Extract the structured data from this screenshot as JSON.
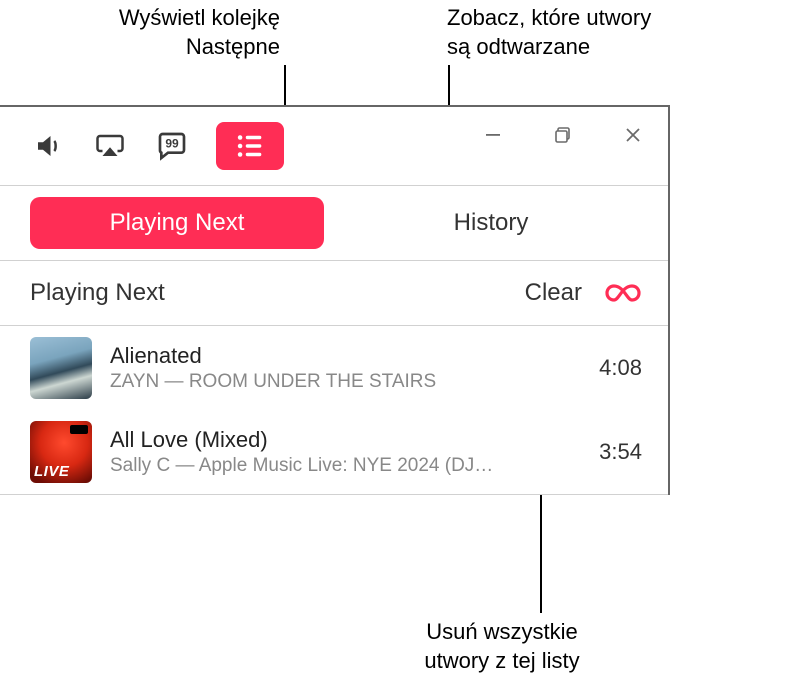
{
  "callouts": {
    "topLeft_l1": "Wyświetl kolejkę",
    "topLeft_l2": "Następne",
    "topRight_l1": "Zobacz, które utwory",
    "topRight_l2": "są odtwarzane",
    "bottom_l1": "Usuń wszystkie",
    "bottom_l2": "utwory z tej listy"
  },
  "tabs": {
    "playingNext": "Playing Next",
    "history": "History"
  },
  "section": {
    "title": "Playing Next",
    "clear": "Clear"
  },
  "tracks": [
    {
      "title": "Alienated",
      "subtitle": "ZAYN — ROOM UNDER THE STAIRS",
      "duration": "4:08"
    },
    {
      "title": "All Love (Mixed)",
      "subtitle": "Sally C — Apple Music Live: NYE 2024 (DJ…",
      "duration": "3:54"
    }
  ]
}
